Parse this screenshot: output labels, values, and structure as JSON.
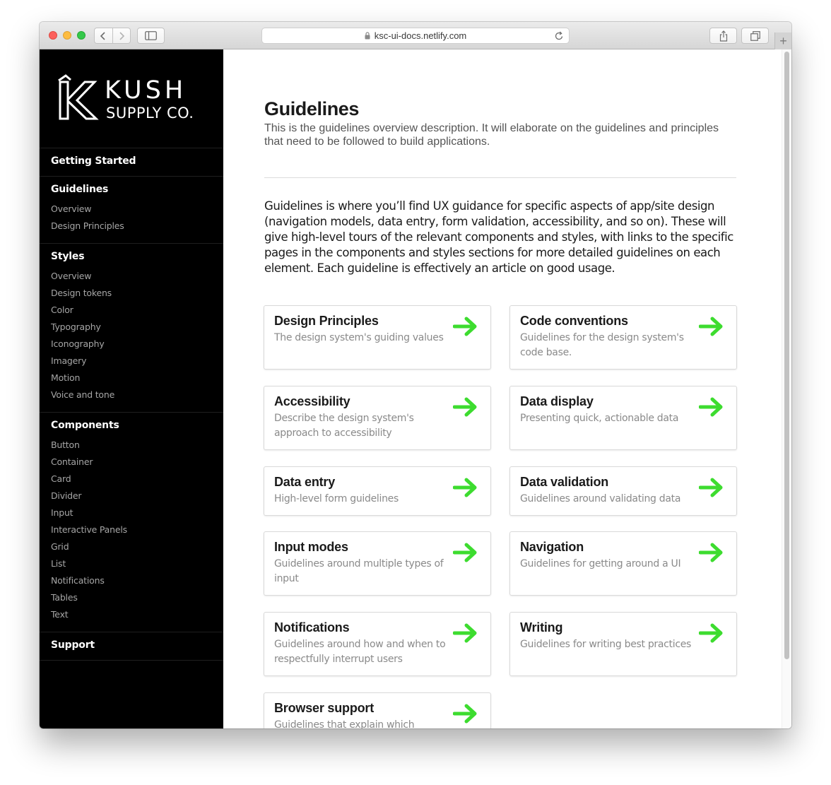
{
  "browser": {
    "url": "ksc-ui-docs.netlify.com",
    "new_tab_label": "+"
  },
  "brand": {
    "word1": "KUSH",
    "word2": "SUPPLY CO.",
    "accent": "#3ddc2f"
  },
  "sidebar": {
    "sections": [
      {
        "heading": "Getting Started",
        "links": []
      },
      {
        "heading": "Guidelines",
        "links": [
          "Overview",
          "Design Principles"
        ]
      },
      {
        "heading": "Styles",
        "links": [
          "Overview",
          "Design tokens",
          "Color",
          "Typography",
          "Iconography",
          "Imagery",
          "Motion",
          "Voice and tone"
        ]
      },
      {
        "heading": "Components",
        "links": [
          "Button",
          "Container",
          "Card",
          "Divider",
          "Input",
          "Interactive Panels",
          "Grid",
          "List",
          "Notifications",
          "Tables",
          "Text"
        ]
      },
      {
        "heading": "Support",
        "links": []
      }
    ]
  },
  "main": {
    "title": "Guidelines",
    "description": "This is the guidelines overview description. It will elaborate on the guidelines and principles that need to be followed to build applications.",
    "intro": "Guidelines is where you’ll find UX guidance for specific aspects of app/site design (navigation models, data entry, form validation, accessibility, and so on). These will give high-level tours of the relevant components and styles, with links to the specific pages in the components and styles sections for more detailed guidelines on each element. Each guideline is effectively an article on good usage.",
    "cards": [
      {
        "title": "Design Principles",
        "desc": "The design system's guiding values"
      },
      {
        "title": "Code conventions",
        "desc": "Guidelines for the design system's code base."
      },
      {
        "title": "Accessibility",
        "desc": "Describe the design system's approach to accessibility"
      },
      {
        "title": "Data display",
        "desc": "Presenting quick, actionable data"
      },
      {
        "title": "Data entry",
        "desc": "High-level form guidelines"
      },
      {
        "title": "Data validation",
        "desc": "Guidelines around validating data"
      },
      {
        "title": "Input modes",
        "desc": "Guidelines around multiple types of input"
      },
      {
        "title": "Navigation",
        "desc": "Guidelines for getting around a UI"
      },
      {
        "title": "Notifications",
        "desc": "Guidelines around how and when to respectfully interrupt users"
      },
      {
        "title": "Writing",
        "desc": "Guidelines for writing best practices"
      },
      {
        "title": "Browser support",
        "desc": "Guidelines that explain which"
      }
    ]
  }
}
